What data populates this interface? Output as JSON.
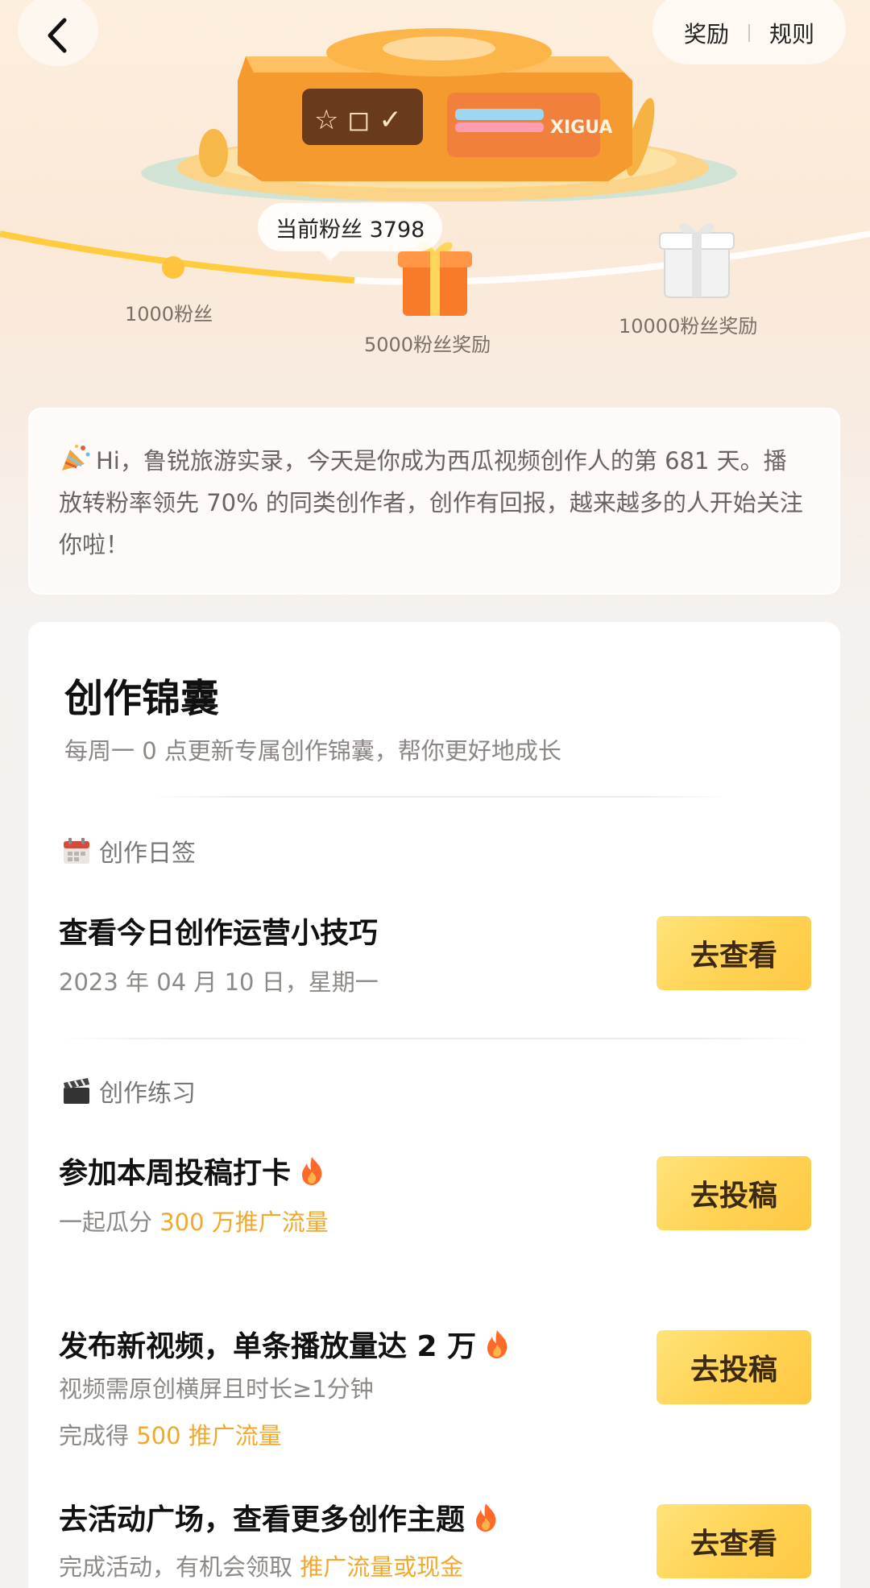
{
  "header": {
    "rewards_label": "奖励",
    "rules_label": "规则"
  },
  "hero": {
    "brand": "XIGUA",
    "current_followers_label": "当前粉丝 3798",
    "milestones": [
      {
        "label": "1000粉丝"
      },
      {
        "label": "5000粉丝奖励"
      },
      {
        "label": "10000粉丝奖励"
      }
    ],
    "progress_fraction": 0.38
  },
  "greeting": {
    "text": "Hi，鲁锐旅游实录，今天是你成为西瓜视频创作人的第 681 天。播放转粉率领先 70% 的同类创作者，创作有回报，越来越多的人开始关注你啦！"
  },
  "card": {
    "title": "创作锦囊",
    "subtitle": "每周一 0 点更新专属创作锦囊，帮你更好地成长",
    "daily": {
      "section_label": "创作日签",
      "task_title": "查看今日创作运营小技巧",
      "task_date": "2023 年 04 月 10 日，星期一",
      "button": "去查看"
    },
    "practice": {
      "section_label": "创作练习",
      "tasks": [
        {
          "title": "参加本周投稿打卡",
          "sub_prefix": "一起瓜分 ",
          "sub_highlight": "300 万推广流量",
          "button": "去投稿"
        },
        {
          "title": "发布新视频，单条播放量达 2 万",
          "requirement": "视频需原创横屏且时长≥1分钟",
          "sub_prefix": "完成得 ",
          "sub_highlight": "500 推广流量",
          "button": "去投稿"
        },
        {
          "title": "去活动广场，查看更多创作主题",
          "sub_prefix": "完成活动，有机会领取 ",
          "sub_highlight": "推广流量或现金",
          "button": "去查看"
        }
      ]
    }
  },
  "colors": {
    "accent_yellow": "#ffd252",
    "highlight_orange": "#f0a92e",
    "fire": "#ff6a2b"
  }
}
